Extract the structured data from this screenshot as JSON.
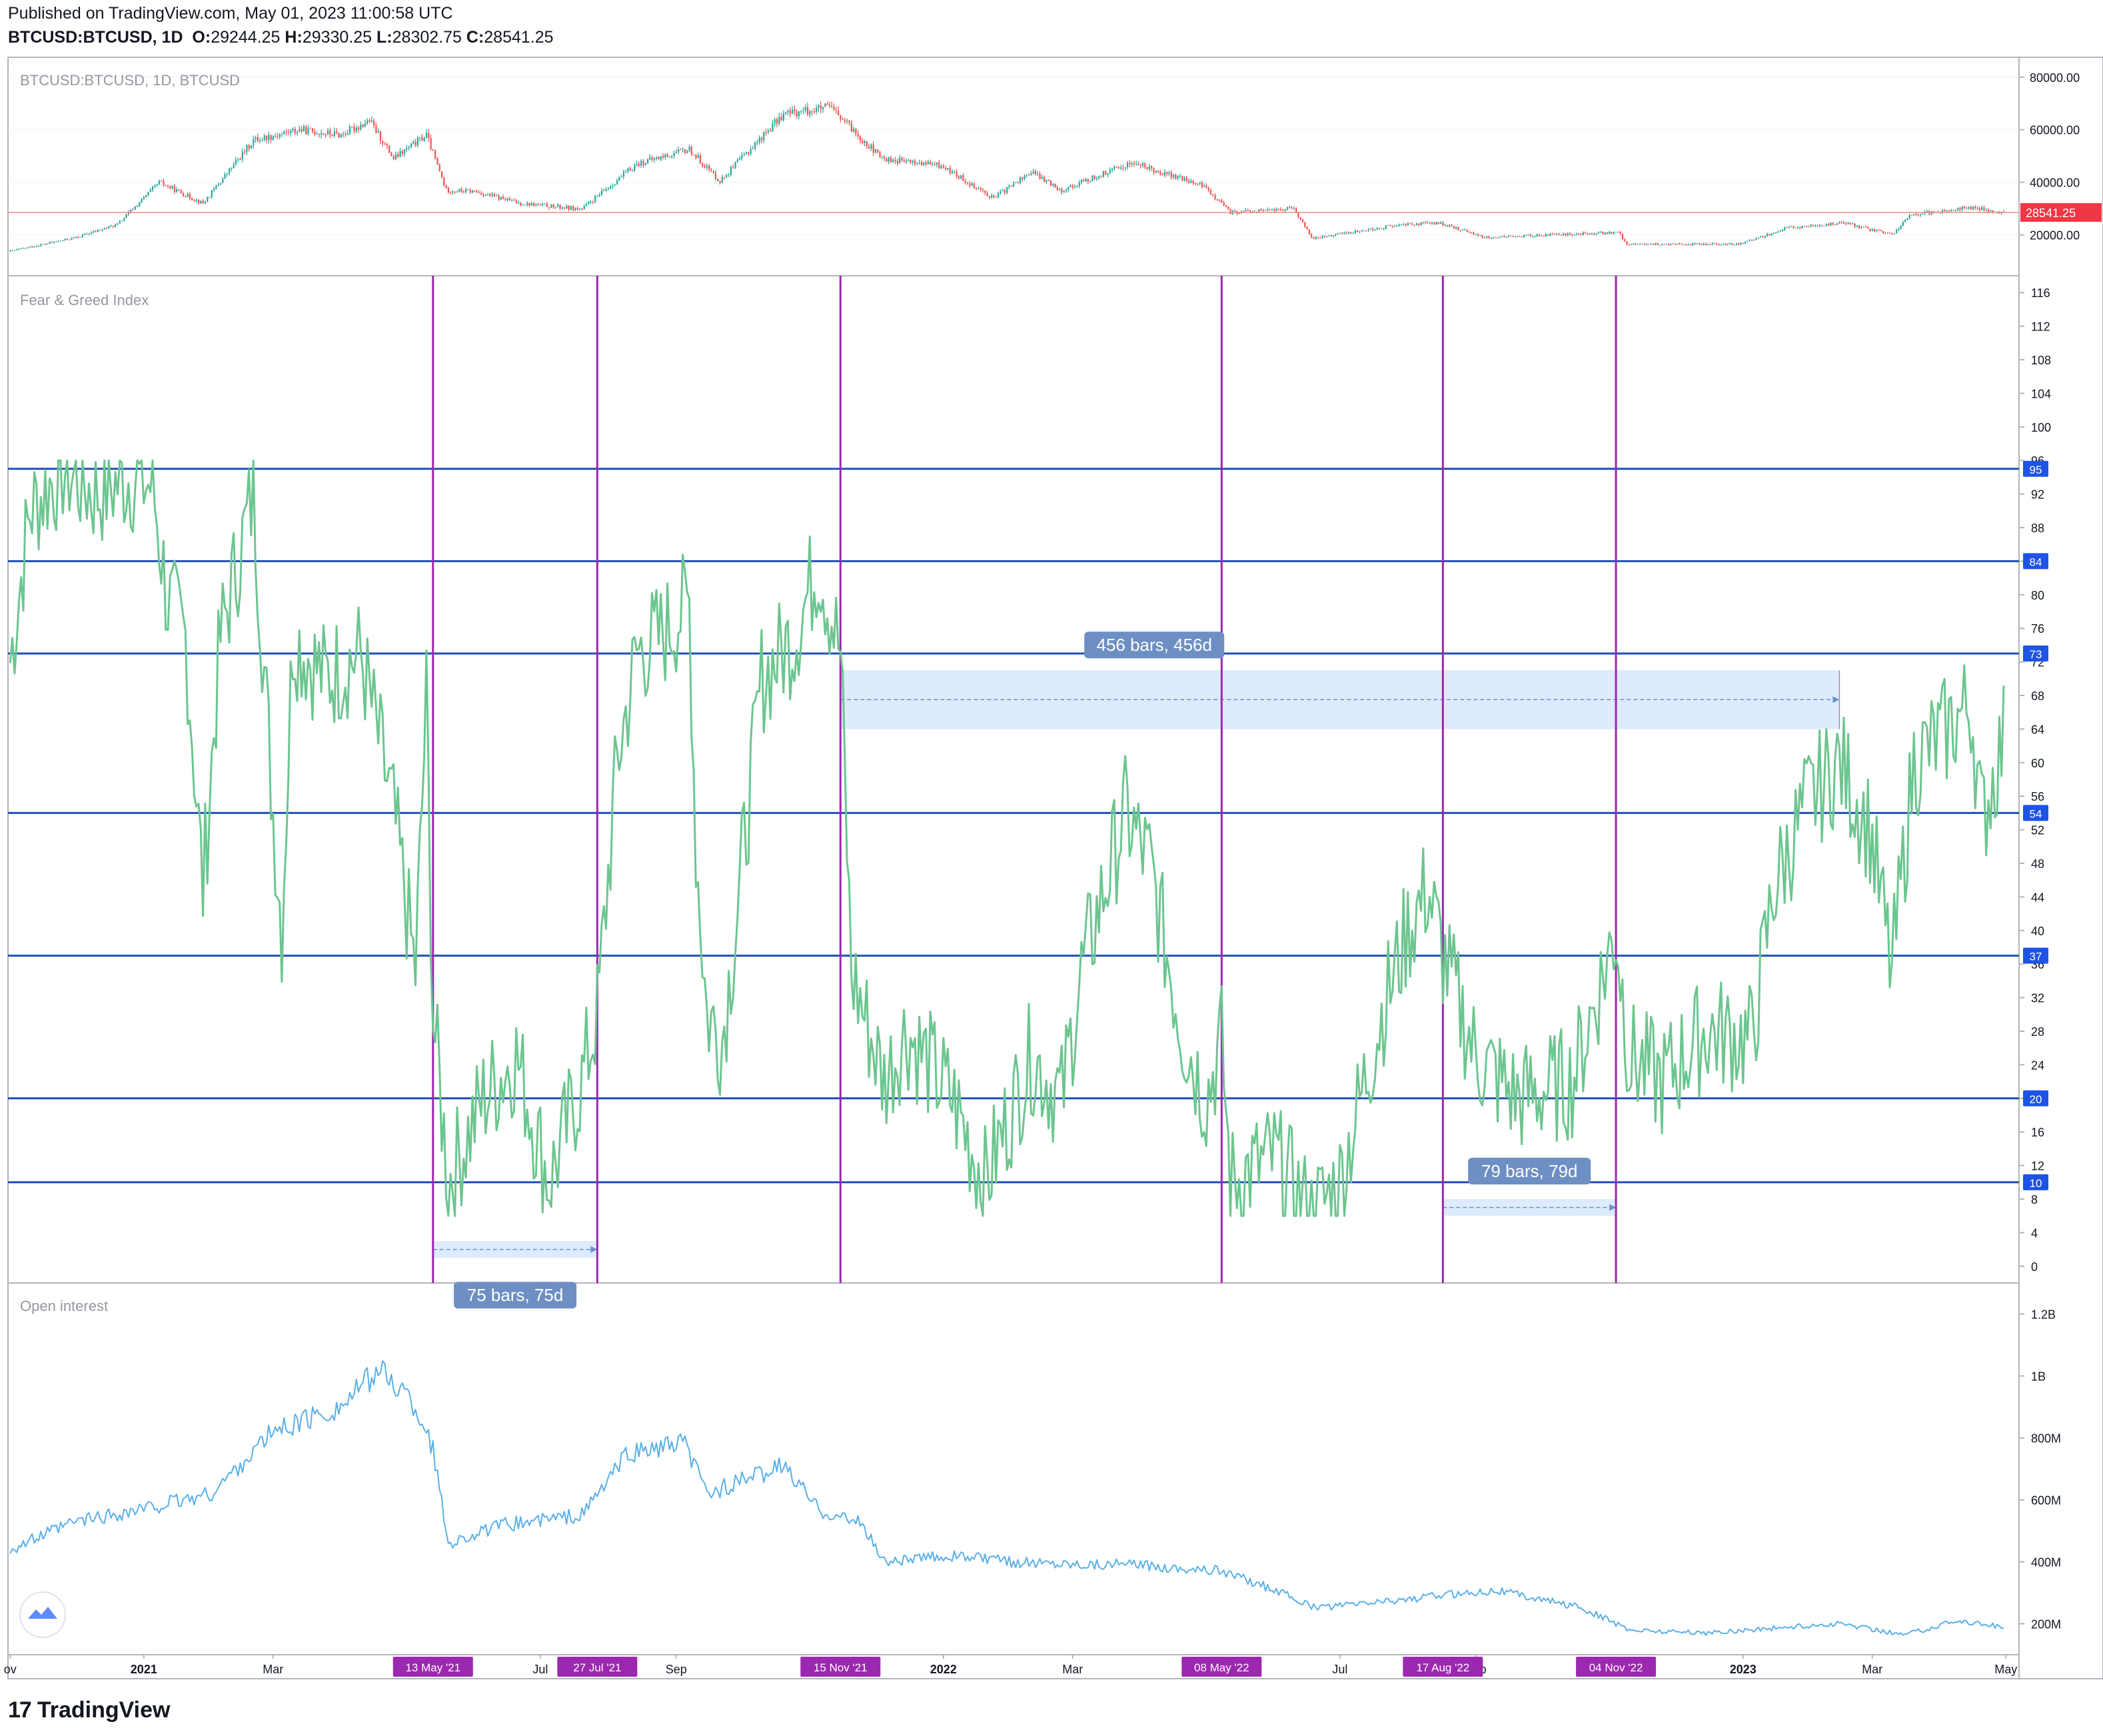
{
  "header": {
    "published": "Published on TradingView.com, May 01, 2023 11:00:58 UTC",
    "symbol": "BTCUSD:BTCUSD, 1D",
    "o_label": "O:",
    "o_value": "29244.25",
    "h_label": "H:",
    "h_value": "29330.25",
    "l_label": "L:",
    "l_value": "28302.75",
    "c_label": "C:",
    "c_value": "28541.25"
  },
  "footer": {
    "brand": "TradingView"
  },
  "colors": {
    "up": "#26a69a",
    "down": "#ef5350",
    "fng": "#6cc58f",
    "oi": "#5ab0e8",
    "level": "#1e4fb4",
    "vline": "#9c27b0",
    "range": "#d7e8fb",
    "price_line": "#f28b82"
  },
  "chart_data": [
    {
      "type": "candlestick",
      "title": "BTCUSD:BTCUSD, 1D, BTCUSD",
      "ylim": [
        8000,
        84000
      ],
      "yticks": [
        20000,
        40000,
        60000,
        80000
      ],
      "ytick_labels": [
        "20000.00",
        "40000.00",
        "60000.00",
        "80000.00"
      ],
      "last_price": 28541.25,
      "last_price_label": "28541.25",
      "keypoints": [
        [
          "2020-11-01",
          13800
        ],
        [
          "2020-12-01",
          19000
        ],
        [
          "2020-12-20",
          24000
        ],
        [
          "2021-01-08",
          40000
        ],
        [
          "2021-01-28",
          32000
        ],
        [
          "2021-02-20",
          56000
        ],
        [
          "2021-03-13",
          60000
        ],
        [
          "2021-04-01",
          58000
        ],
        [
          "2021-04-14",
          63500
        ],
        [
          "2021-04-25",
          49000
        ],
        [
          "2021-05-10",
          58000
        ],
        [
          "2021-05-19",
          37000
        ],
        [
          "2021-06-01",
          36500
        ],
        [
          "2021-06-22",
          32000
        ],
        [
          "2021-07-20",
          29800
        ],
        [
          "2021-08-14",
          47000
        ],
        [
          "2021-09-07",
          52500
        ],
        [
          "2021-09-21",
          40500
        ],
        [
          "2021-10-20",
          66000
        ],
        [
          "2021-11-10",
          68500
        ],
        [
          "2021-12-04",
          49000
        ],
        [
          "2021-12-31",
          46300
        ],
        [
          "2022-01-24",
          34000
        ],
        [
          "2022-02-10",
          44000
        ],
        [
          "2022-02-24",
          37000
        ],
        [
          "2022-03-28",
          47500
        ],
        [
          "2022-04-30",
          38500
        ],
        [
          "2022-05-12",
          28500
        ],
        [
          "2022-06-10",
          30000
        ],
        [
          "2022-06-18",
          18800
        ],
        [
          "2022-07-30",
          24000
        ],
        [
          "2022-08-15",
          24500
        ],
        [
          "2022-09-06",
          19000
        ],
        [
          "2022-11-05",
          21000
        ],
        [
          "2022-11-09",
          16500
        ],
        [
          "2022-12-31",
          16500
        ],
        [
          "2023-01-20",
          22500
        ],
        [
          "2023-02-16",
          24500
        ],
        [
          "2023-03-10",
          20000
        ],
        [
          "2023-03-18",
          27500
        ],
        [
          "2023-04-14",
          30500
        ],
        [
          "2023-04-30",
          28541
        ]
      ]
    },
    {
      "type": "line",
      "title": "Fear & Greed Index",
      "ylim": [
        -2,
        118
      ],
      "yticks": [
        0,
        4,
        8,
        12,
        16,
        20,
        24,
        28,
        32,
        36,
        40,
        44,
        48,
        52,
        56,
        60,
        64,
        68,
        72,
        76,
        80,
        84,
        88,
        92,
        96,
        100,
        104,
        108,
        112,
        116
      ],
      "levels": [
        95,
        84,
        73,
        54,
        37,
        20,
        10
      ],
      "level_labels": [
        "95",
        "84",
        "73",
        "54",
        "37",
        "20",
        "10"
      ],
      "highlight_dates": [
        "2021-05-13",
        "2021-07-27",
        "2021-11-15",
        "2022-05-08",
        "2022-08-17",
        "2022-11-04"
      ],
      "highlight_labels": [
        "13 May '21",
        "27 Jul '21",
        "15 Nov '21",
        "08 May '22",
        "17 Aug '22",
        "04 Nov '22"
      ],
      "ranges": [
        {
          "start": "2021-05-13",
          "end": "2021-07-27",
          "y_low": 1,
          "y_high": 3,
          "label": "75 bars, 75d"
        },
        {
          "start": "2021-11-15",
          "end": "2023-02-14",
          "y_low": 64,
          "y_high": 71,
          "label": "456 bars, 456d"
        },
        {
          "start": "2022-08-17",
          "end": "2022-11-04",
          "y_low": 6,
          "y_high": 8,
          "label": "79 bars, 79d"
        }
      ],
      "keypoints": [
        [
          "2020-11-01",
          72
        ],
        [
          "2020-11-10",
          90
        ],
        [
          "2020-11-25",
          95
        ],
        [
          "2020-12-10",
          92
        ],
        [
          "2020-12-25",
          94
        ],
        [
          "2021-01-05",
          93
        ],
        [
          "2021-01-12",
          79
        ],
        [
          "2021-01-20",
          75
        ],
        [
          "2021-01-28",
          45
        ],
        [
          "2021-02-05",
          75
        ],
        [
          "2021-02-20",
          92
        ],
        [
          "2021-03-01",
          54
        ],
        [
          "2021-03-05",
          40
        ],
        [
          "2021-03-10",
          75
        ],
        [
          "2021-03-25",
          70
        ],
        [
          "2021-04-10",
          73
        ],
        [
          "2021-04-25",
          54
        ],
        [
          "2021-05-05",
          35
        ],
        [
          "2021-05-10",
          68
        ],
        [
          "2021-05-13",
          30
        ],
        [
          "2021-05-20",
          10
        ],
        [
          "2021-06-05",
          20
        ],
        [
          "2021-06-20",
          25
        ],
        [
          "2021-07-05",
          10
        ],
        [
          "2021-07-20",
          22
        ],
        [
          "2021-07-27",
          30
        ],
        [
          "2021-08-05",
          60
        ],
        [
          "2021-08-14",
          73
        ],
        [
          "2021-08-25",
          75
        ],
        [
          "2021-09-07",
          79
        ],
        [
          "2021-09-10",
          50
        ],
        [
          "2021-09-15",
          30
        ],
        [
          "2021-09-22",
          27
        ],
        [
          "2021-09-28",
          40
        ],
        [
          "2021-10-10",
          70
        ],
        [
          "2021-10-25",
          75
        ],
        [
          "2021-11-05",
          84
        ],
        [
          "2021-11-15",
          73
        ],
        [
          "2021-11-20",
          35
        ],
        [
          "2021-12-05",
          22
        ],
        [
          "2021-12-15",
          28
        ],
        [
          "2022-01-05",
          20
        ],
        [
          "2022-01-20",
          10
        ],
        [
          "2022-02-10",
          25
        ],
        [
          "2022-02-24",
          20
        ],
        [
          "2022-03-05",
          35
        ],
        [
          "2022-03-25",
          54
        ],
        [
          "2022-04-05",
          48
        ],
        [
          "2022-04-20",
          28
        ],
        [
          "2022-05-01",
          20
        ],
        [
          "2022-05-08",
          27
        ],
        [
          "2022-05-12",
          10
        ],
        [
          "2022-06-01",
          13
        ],
        [
          "2022-06-18",
          6
        ],
        [
          "2022-07-01",
          10
        ],
        [
          "2022-07-20",
          30
        ],
        [
          "2022-08-01",
          40
        ],
        [
          "2022-08-10",
          45
        ],
        [
          "2022-08-17",
          37
        ],
        [
          "2022-09-01",
          25
        ],
        [
          "2022-09-20",
          20
        ],
        [
          "2022-10-15",
          22
        ],
        [
          "2022-11-04",
          40
        ],
        [
          "2022-11-10",
          25
        ],
        [
          "2022-11-25",
          22
        ],
        [
          "2022-12-15",
          28
        ],
        [
          "2023-01-05",
          27
        ],
        [
          "2023-01-15",
          45
        ],
        [
          "2023-01-30",
          55
        ],
        [
          "2023-02-14",
          60
        ],
        [
          "2023-02-28",
          52
        ],
        [
          "2023-03-10",
          35
        ],
        [
          "2023-03-20",
          60
        ],
        [
          "2023-04-01",
          63
        ],
        [
          "2023-04-15",
          67
        ],
        [
          "2023-04-20",
          53
        ],
        [
          "2023-04-30",
          63
        ]
      ]
    },
    {
      "type": "line",
      "title": "Open interest",
      "ylim": [
        100000000,
        1300000000
      ],
      "yticks": [
        200000000,
        400000000,
        600000000,
        800000000,
        1000000000,
        1200000000
      ],
      "ytick_labels": [
        "200M",
        "400M",
        "600M",
        "800M",
        "1B",
        "1.2B"
      ],
      "keypoints": [
        [
          "2020-11-01",
          440000000
        ],
        [
          "2020-12-01",
          530000000
        ],
        [
          "2021-01-01",
          570000000
        ],
        [
          "2021-02-01",
          620000000
        ],
        [
          "2021-03-01",
          820000000
        ],
        [
          "2021-04-01",
          900000000
        ],
        [
          "2021-04-18",
          1020000000
        ],
        [
          "2021-05-01",
          940000000
        ],
        [
          "2021-05-10",
          830000000
        ],
        [
          "2021-05-13",
          760000000
        ],
        [
          "2021-05-20",
          460000000
        ],
        [
          "2021-06-15",
          520000000
        ],
        [
          "2021-07-20",
          550000000
        ],
        [
          "2021-08-10",
          750000000
        ],
        [
          "2021-09-05",
          780000000
        ],
        [
          "2021-09-15",
          620000000
        ],
        [
          "2021-10-20",
          710000000
        ],
        [
          "2021-11-05",
          570000000
        ],
        [
          "2021-11-25",
          520000000
        ],
        [
          "2021-12-05",
          400000000
        ],
        [
          "2022-01-05",
          420000000
        ],
        [
          "2022-02-01",
          400000000
        ],
        [
          "2022-04-01",
          390000000
        ],
        [
          "2022-05-08",
          370000000
        ],
        [
          "2022-06-01",
          310000000
        ],
        [
          "2022-06-20",
          250000000
        ],
        [
          "2022-08-15",
          290000000
        ],
        [
          "2022-09-10",
          310000000
        ],
        [
          "2022-10-20",
          250000000
        ],
        [
          "2022-11-10",
          180000000
        ],
        [
          "2022-12-15",
          170000000
        ],
        [
          "2023-01-15",
          185000000
        ],
        [
          "2023-02-15",
          200000000
        ],
        [
          "2023-03-15",
          165000000
        ],
        [
          "2023-04-10",
          210000000
        ],
        [
          "2023-04-30",
          190000000
        ]
      ]
    }
  ],
  "x_axis": {
    "start": "2020-10-31",
    "end": "2023-05-07",
    "ticks": [
      {
        "date": "2020-11-01",
        "label": "ov"
      },
      {
        "date": "2021-01-01",
        "label": "2021"
      },
      {
        "date": "2021-03-01",
        "label": "Mar"
      },
      {
        "date": "2021-07-01",
        "label": "Jul"
      },
      {
        "date": "2021-09-01",
        "label": "Sep"
      },
      {
        "date": "2022-01-01",
        "label": "2022"
      },
      {
        "date": "2022-03-01",
        "label": "Mar"
      },
      {
        "date": "2022-07-01",
        "label": "Jul"
      },
      {
        "date": "2022-09-01",
        "label": "Sep"
      },
      {
        "date": "2023-01-01",
        "label": "2023"
      },
      {
        "date": "2023-03-01",
        "label": "Mar"
      },
      {
        "date": "2023-05-01",
        "label": "May"
      }
    ]
  }
}
